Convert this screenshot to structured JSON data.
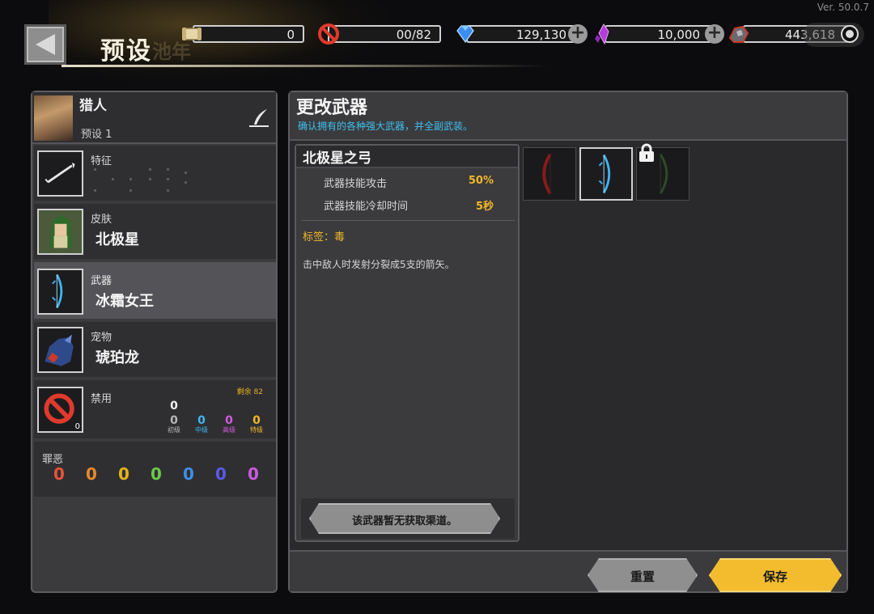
{
  "version": "Ver. 50.0.7",
  "header": {
    "title": "预设",
    "ghost_text": "池年"
  },
  "resources": [
    {
      "icon": "scroll-icon",
      "value": "0"
    },
    {
      "icon": "ban-icon",
      "value": "00/82"
    },
    {
      "icon": "diamond-icon",
      "value": "129,130"
    },
    {
      "icon": "crystal-icon",
      "value": "10,000"
    },
    {
      "icon": "ore-icon",
      "value": "443,618"
    }
  ],
  "hero": {
    "name": "猎人",
    "preset": "预设 1"
  },
  "slots": {
    "trait": {
      "category": "特征"
    },
    "skin": {
      "category": "皮肤",
      "name": "北极星"
    },
    "weapon": {
      "category": "武器",
      "name": "冰霜女王"
    },
    "pet": {
      "category": "宠物",
      "name": "琥珀龙"
    },
    "ban": {
      "category": "禁用",
      "remaining": "剩余 82",
      "badge": "0",
      "total": "0",
      "tiers": [
        {
          "count": "0",
          "label": "初级",
          "color": "#b8b8b8"
        },
        {
          "count": "0",
          "label": "中级",
          "color": "#3fb6f0"
        },
        {
          "count": "0",
          "label": "高级",
          "color": "#d45ae0"
        },
        {
          "count": "0",
          "label": "特级",
          "color": "#f0b728"
        }
      ]
    }
  },
  "sins": {
    "label": "罪恶",
    "values": [
      {
        "v": "0",
        "color": "#e8523a"
      },
      {
        "v": "0",
        "color": "#e88a2c"
      },
      {
        "v": "0",
        "color": "#e6b21d"
      },
      {
        "v": "0",
        "color": "#6cc84a"
      },
      {
        "v": "0",
        "color": "#3f8ee6"
      },
      {
        "v": "0",
        "color": "#5a5ae8"
      },
      {
        "v": "0",
        "color": "#c95ae0"
      }
    ]
  },
  "panel": {
    "title": "更改武器",
    "subtitle": "确认拥有的各种强大武器，并全副武装。",
    "weapon_name": "北极星之弓",
    "stats": [
      {
        "label": "武器技能攻击",
        "value": "50%"
      },
      {
        "label": "武器技能冷却时间",
        "value": "5秒"
      }
    ],
    "tag": "标签：毒",
    "description": "击中敌人时发射分裂成5支的箭矢。",
    "obtain_label": "该武器暂无获取渠道。",
    "weapon_icons": [
      "red-bow-icon",
      "frost-bow-icon",
      "green-bow-icon"
    ]
  },
  "buttons": {
    "reset": "重置",
    "save": "保存"
  },
  "colors": {
    "accent": "#f3bb2e",
    "info": "#3ec0ee"
  }
}
